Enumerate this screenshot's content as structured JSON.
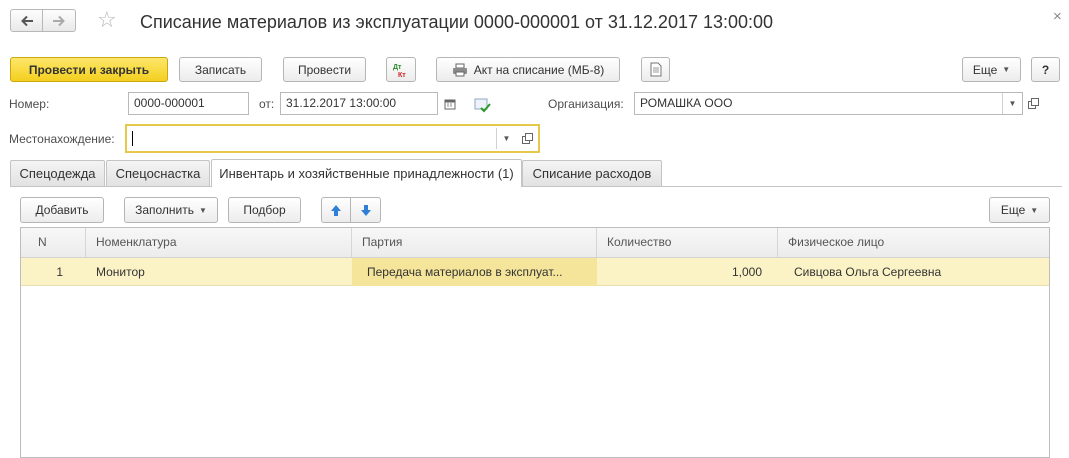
{
  "window": {
    "title": "Списание материалов из эксплуатации 0000-000001 от 31.12.2017 13:00:00",
    "close_symbol": "×"
  },
  "toolbar": {
    "post_and_close": "Провести и закрыть",
    "save": "Записать",
    "post": "Провести",
    "act_writeoff": "Акт на списание (МБ-8)",
    "more": "Еще",
    "help": "?"
  },
  "form": {
    "number_label": "Номер:",
    "number_value": "0000-000001",
    "date_label": "от:",
    "date_value": "31.12.2017 13:00:00",
    "org_label": "Организация:",
    "org_value": "РОМАШКА ООО",
    "location_label": "Местонахождение:",
    "location_value": ""
  },
  "tabs": [
    {
      "label": "Спецодежда",
      "active": false
    },
    {
      "label": "Спецоснастка",
      "active": false
    },
    {
      "label": "Инвентарь и хозяйственные принадлежности (1)",
      "active": true
    },
    {
      "label": "Списание расходов",
      "active": false
    }
  ],
  "table_toolbar": {
    "add": "Добавить",
    "fill": "Заполнить",
    "pick": "Подбор",
    "more": "Еще"
  },
  "table": {
    "columns": [
      "N",
      "Номенклатура",
      "Партия",
      "Количество",
      "Физическое лицо"
    ],
    "rows": [
      {
        "n": "1",
        "item": "Монитор",
        "batch": "Передача материалов в эксплуат...",
        "qty": "1,000",
        "person": "Сивцова Ольга Сергеевна"
      }
    ]
  },
  "colors": {
    "primary_button": "#f4cf1f",
    "focus_border": "#e6c84a",
    "selected_row": "#fbf3c6",
    "arrow_blue": "#2f7fd8"
  }
}
